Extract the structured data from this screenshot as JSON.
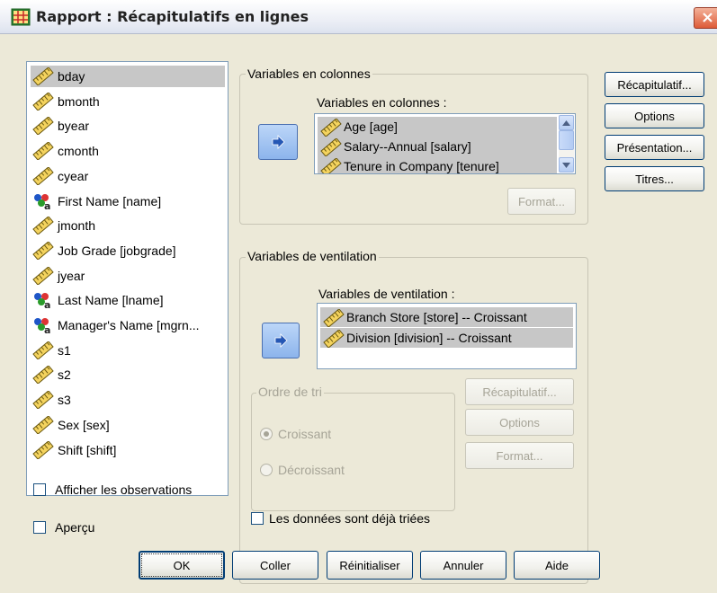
{
  "window": {
    "title": "Rapport : Récapitulatifs en lignes",
    "accent": "#de5b38"
  },
  "source_variables": [
    {
      "label": "bday",
      "icon": "scale-icon",
      "selected": true
    },
    {
      "label": "bmonth",
      "icon": "scale-icon"
    },
    {
      "label": "byear",
      "icon": "scale-icon"
    },
    {
      "label": "cmonth",
      "icon": "scale-icon"
    },
    {
      "label": "cyear",
      "icon": "scale-icon"
    },
    {
      "label": "First Name [name]",
      "icon": "nominal-string-icon"
    },
    {
      "label": "jmonth",
      "icon": "scale-icon"
    },
    {
      "label": "Job Grade [jobgrade]",
      "icon": "scale-icon"
    },
    {
      "label": "jyear",
      "icon": "scale-icon"
    },
    {
      "label": "Last Name [lname]",
      "icon": "nominal-string-icon"
    },
    {
      "label": "Manager's Name [mgrn...",
      "icon": "nominal-string-icon"
    },
    {
      "label": "s1",
      "icon": "scale-icon"
    },
    {
      "label": "s2",
      "icon": "scale-icon"
    },
    {
      "label": "s3",
      "icon": "scale-icon"
    },
    {
      "label": "Sex [sex]",
      "icon": "scale-icon"
    },
    {
      "label": "Shift [shift]",
      "icon": "scale-icon"
    }
  ],
  "columns_group": {
    "title": "Variables en colonnes",
    "list_label": "Variables en colonnes :",
    "items": [
      "Age [age]",
      "Salary--Annual [salary]",
      "Tenure in Company [tenure]"
    ],
    "format_button": "Format..."
  },
  "breaks_group": {
    "title": "Variables de ventilation",
    "list_label": "Variables de ventilation :",
    "items": [
      "Branch Store [store] -- Croissant",
      "Division [division] -- Croissant"
    ],
    "sort_title": "Ordre de tri",
    "sort_ascending": "Croissant",
    "sort_descending": "Décroissant",
    "summary_button": "Récapitulatif...",
    "options_button": "Options",
    "format_button": "Format..."
  },
  "side_buttons": {
    "summary": "Récapitulatif...",
    "options": "Options",
    "layout": "Présentation...",
    "titles": "Titres..."
  },
  "checkboxes": {
    "show_cases": "Afficher les observations",
    "preview": "Aperçu",
    "already_sorted": "Les données sont déjà triées"
  },
  "bottom_buttons": {
    "ok": "OK",
    "paste": "Coller",
    "reset": "Réinitialiser",
    "cancel": "Annuler",
    "help": "Aide"
  }
}
